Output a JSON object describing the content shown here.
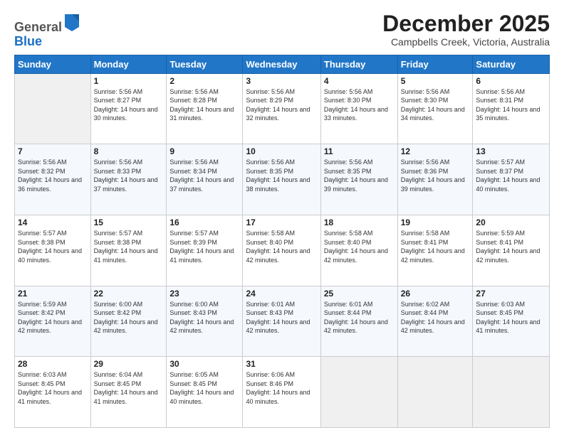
{
  "logo": {
    "general": "General",
    "blue": "Blue"
  },
  "header": {
    "month": "December 2025",
    "location": "Campbells Creek, Victoria, Australia"
  },
  "weekdays": [
    "Sunday",
    "Monday",
    "Tuesday",
    "Wednesday",
    "Thursday",
    "Friday",
    "Saturday"
  ],
  "weeks": [
    [
      {
        "day": "",
        "empty": true
      },
      {
        "day": "1",
        "sunrise": "Sunrise: 5:56 AM",
        "sunset": "Sunset: 8:27 PM",
        "daylight": "Daylight: 14 hours and 30 minutes."
      },
      {
        "day": "2",
        "sunrise": "Sunrise: 5:56 AM",
        "sunset": "Sunset: 8:28 PM",
        "daylight": "Daylight: 14 hours and 31 minutes."
      },
      {
        "day": "3",
        "sunrise": "Sunrise: 5:56 AM",
        "sunset": "Sunset: 8:29 PM",
        "daylight": "Daylight: 14 hours and 32 minutes."
      },
      {
        "day": "4",
        "sunrise": "Sunrise: 5:56 AM",
        "sunset": "Sunset: 8:30 PM",
        "daylight": "Daylight: 14 hours and 33 minutes."
      },
      {
        "day": "5",
        "sunrise": "Sunrise: 5:56 AM",
        "sunset": "Sunset: 8:30 PM",
        "daylight": "Daylight: 14 hours and 34 minutes."
      },
      {
        "day": "6",
        "sunrise": "Sunrise: 5:56 AM",
        "sunset": "Sunset: 8:31 PM",
        "daylight": "Daylight: 14 hours and 35 minutes."
      }
    ],
    [
      {
        "day": "7",
        "sunrise": "Sunrise: 5:56 AM",
        "sunset": "Sunset: 8:32 PM",
        "daylight": "Daylight: 14 hours and 36 minutes."
      },
      {
        "day": "8",
        "sunrise": "Sunrise: 5:56 AM",
        "sunset": "Sunset: 8:33 PM",
        "daylight": "Daylight: 14 hours and 37 minutes."
      },
      {
        "day": "9",
        "sunrise": "Sunrise: 5:56 AM",
        "sunset": "Sunset: 8:34 PM",
        "daylight": "Daylight: 14 hours and 37 minutes."
      },
      {
        "day": "10",
        "sunrise": "Sunrise: 5:56 AM",
        "sunset": "Sunset: 8:35 PM",
        "daylight": "Daylight: 14 hours and 38 minutes."
      },
      {
        "day": "11",
        "sunrise": "Sunrise: 5:56 AM",
        "sunset": "Sunset: 8:35 PM",
        "daylight": "Daylight: 14 hours and 39 minutes."
      },
      {
        "day": "12",
        "sunrise": "Sunrise: 5:56 AM",
        "sunset": "Sunset: 8:36 PM",
        "daylight": "Daylight: 14 hours and 39 minutes."
      },
      {
        "day": "13",
        "sunrise": "Sunrise: 5:57 AM",
        "sunset": "Sunset: 8:37 PM",
        "daylight": "Daylight: 14 hours and 40 minutes."
      }
    ],
    [
      {
        "day": "14",
        "sunrise": "Sunrise: 5:57 AM",
        "sunset": "Sunset: 8:38 PM",
        "daylight": "Daylight: 14 hours and 40 minutes."
      },
      {
        "day": "15",
        "sunrise": "Sunrise: 5:57 AM",
        "sunset": "Sunset: 8:38 PM",
        "daylight": "Daylight: 14 hours and 41 minutes."
      },
      {
        "day": "16",
        "sunrise": "Sunrise: 5:57 AM",
        "sunset": "Sunset: 8:39 PM",
        "daylight": "Daylight: 14 hours and 41 minutes."
      },
      {
        "day": "17",
        "sunrise": "Sunrise: 5:58 AM",
        "sunset": "Sunset: 8:40 PM",
        "daylight": "Daylight: 14 hours and 42 minutes."
      },
      {
        "day": "18",
        "sunrise": "Sunrise: 5:58 AM",
        "sunset": "Sunset: 8:40 PM",
        "daylight": "Daylight: 14 hours and 42 minutes."
      },
      {
        "day": "19",
        "sunrise": "Sunrise: 5:58 AM",
        "sunset": "Sunset: 8:41 PM",
        "daylight": "Daylight: 14 hours and 42 minutes."
      },
      {
        "day": "20",
        "sunrise": "Sunrise: 5:59 AM",
        "sunset": "Sunset: 8:41 PM",
        "daylight": "Daylight: 14 hours and 42 minutes."
      }
    ],
    [
      {
        "day": "21",
        "sunrise": "Sunrise: 5:59 AM",
        "sunset": "Sunset: 8:42 PM",
        "daylight": "Daylight: 14 hours and 42 minutes."
      },
      {
        "day": "22",
        "sunrise": "Sunrise: 6:00 AM",
        "sunset": "Sunset: 8:42 PM",
        "daylight": "Daylight: 14 hours and 42 minutes."
      },
      {
        "day": "23",
        "sunrise": "Sunrise: 6:00 AM",
        "sunset": "Sunset: 8:43 PM",
        "daylight": "Daylight: 14 hours and 42 minutes."
      },
      {
        "day": "24",
        "sunrise": "Sunrise: 6:01 AM",
        "sunset": "Sunset: 8:43 PM",
        "daylight": "Daylight: 14 hours and 42 minutes."
      },
      {
        "day": "25",
        "sunrise": "Sunrise: 6:01 AM",
        "sunset": "Sunset: 8:44 PM",
        "daylight": "Daylight: 14 hours and 42 minutes."
      },
      {
        "day": "26",
        "sunrise": "Sunrise: 6:02 AM",
        "sunset": "Sunset: 8:44 PM",
        "daylight": "Daylight: 14 hours and 42 minutes."
      },
      {
        "day": "27",
        "sunrise": "Sunrise: 6:03 AM",
        "sunset": "Sunset: 8:45 PM",
        "daylight": "Daylight: 14 hours and 41 minutes."
      }
    ],
    [
      {
        "day": "28",
        "sunrise": "Sunrise: 6:03 AM",
        "sunset": "Sunset: 8:45 PM",
        "daylight": "Daylight: 14 hours and 41 minutes."
      },
      {
        "day": "29",
        "sunrise": "Sunrise: 6:04 AM",
        "sunset": "Sunset: 8:45 PM",
        "daylight": "Daylight: 14 hours and 41 minutes."
      },
      {
        "day": "30",
        "sunrise": "Sunrise: 6:05 AM",
        "sunset": "Sunset: 8:45 PM",
        "daylight": "Daylight: 14 hours and 40 minutes."
      },
      {
        "day": "31",
        "sunrise": "Sunrise: 6:06 AM",
        "sunset": "Sunset: 8:46 PM",
        "daylight": "Daylight: 14 hours and 40 minutes."
      },
      {
        "day": "",
        "empty": true
      },
      {
        "day": "",
        "empty": true
      },
      {
        "day": "",
        "empty": true
      }
    ]
  ]
}
